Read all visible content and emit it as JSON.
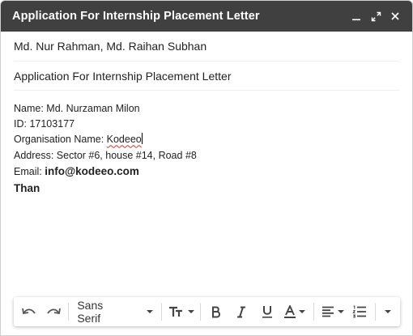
{
  "window": {
    "title": "Application For Internship Placement Letter"
  },
  "compose": {
    "recipients": "Md. Nur Rahman, Md. Raihan Subhan",
    "subject": "Application For Internship Placement Letter",
    "body": {
      "name_line": "Name: Md. Nurzaman Milon",
      "id_line": "ID: 17103177",
      "org_prefix": "Organisation Name: ",
      "org_value": "Kodeeo",
      "address_line": "Address: Sector #6, house #14, Road #8",
      "email_prefix": "Email: ",
      "email_value": "info@kodeeo.com",
      "than_line": "Than"
    }
  },
  "toolbar": {
    "font_family": "Sans Serif",
    "icons": [
      "undo-icon",
      "redo-icon",
      "text-size-icon",
      "bold-icon",
      "italic-icon",
      "underline-icon",
      "text-color-icon",
      "align-icon",
      "numbered-list-icon",
      "more-formatting-icon"
    ]
  },
  "colors": {
    "titlebar": "#404040",
    "spell_error": "#d93025"
  }
}
